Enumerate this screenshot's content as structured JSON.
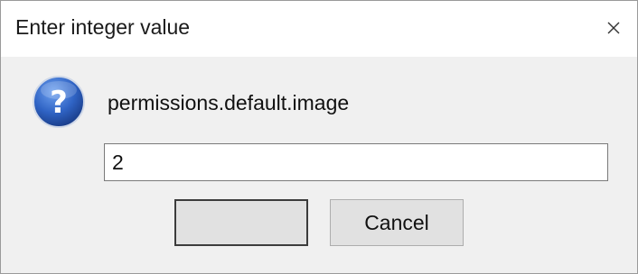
{
  "window": {
    "title": "Enter integer value",
    "close_icon": "close-icon"
  },
  "dialog": {
    "icon": "question-icon",
    "prompt": "permissions.default.image",
    "input_value": "2",
    "buttons": {
      "ok_label": "",
      "cancel_label": "Cancel"
    }
  },
  "colors": {
    "titlebar_bg": "#ffffff",
    "body_bg": "#f0f0f0",
    "icon_blue": "#2f63c4"
  }
}
